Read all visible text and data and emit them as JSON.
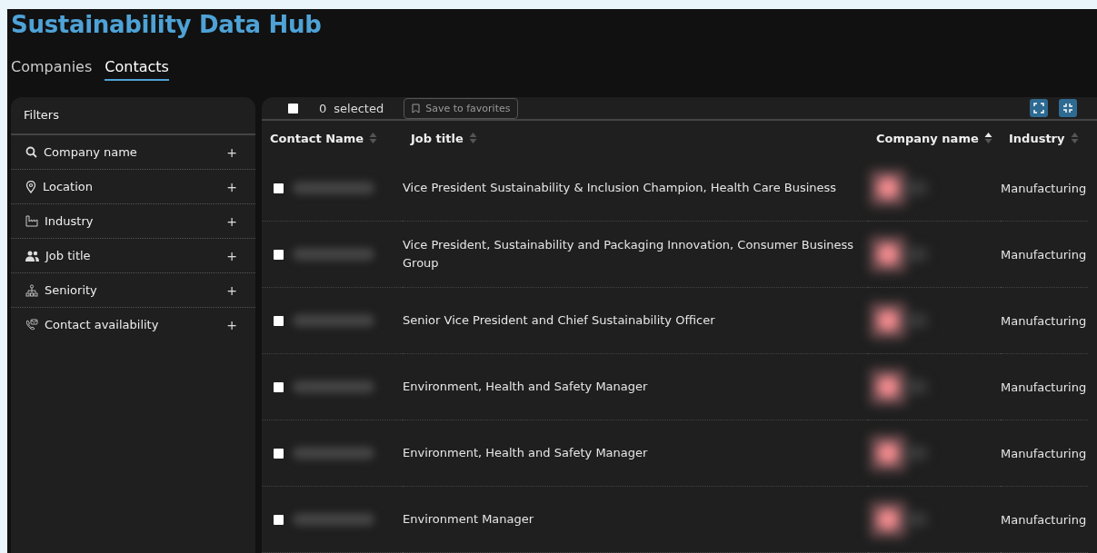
{
  "app": {
    "title": "Sustainability Data Hub"
  },
  "tabs": [
    {
      "label": "Companies",
      "selected": false
    },
    {
      "label": "Contacts",
      "selected": true
    }
  ],
  "filters": {
    "title": "Filters",
    "items": [
      {
        "label": "Company name",
        "action": "+"
      },
      {
        "label": "Location",
        "action": "+"
      },
      {
        "label": "Industry",
        "action": "+"
      },
      {
        "label": "Job title",
        "action": "+"
      },
      {
        "label": "Seniority",
        "action": "+"
      },
      {
        "label": "Contact availability",
        "action": "+"
      }
    ]
  },
  "toolbar": {
    "select_all": {
      "checked": false
    },
    "count": "0",
    "count_label": "selected",
    "save_button": "Save to favorites"
  },
  "table": {
    "columns": [
      {
        "label": "Contact Name",
        "sorted": false
      },
      {
        "label": "Job title",
        "sorted": false
      },
      {
        "label": "Company name",
        "sorted": true
      },
      {
        "label": "Industry",
        "sorted": false
      }
    ],
    "rows": [
      {
        "checked": false,
        "job_title": "Vice President Sustainability & Inclusion Champion, Health Care Business",
        "industry": "Manufacturing"
      },
      {
        "checked": false,
        "job_title": "Vice President, Sustainability and Packaging Innovation, Consumer Business Group",
        "industry": "Manufacturing"
      },
      {
        "checked": false,
        "job_title": "Senior Vice President and Chief Sustainability Officer",
        "industry": "Manufacturing"
      },
      {
        "checked": false,
        "job_title": "Environment, Health and Safety Manager",
        "industry": "Manufacturing"
      },
      {
        "checked": false,
        "job_title": "Environment, Health and Safety Manager",
        "industry": "Manufacturing"
      },
      {
        "checked": false,
        "job_title": "Environment Manager",
        "industry": "Manufacturing"
      }
    ]
  }
}
